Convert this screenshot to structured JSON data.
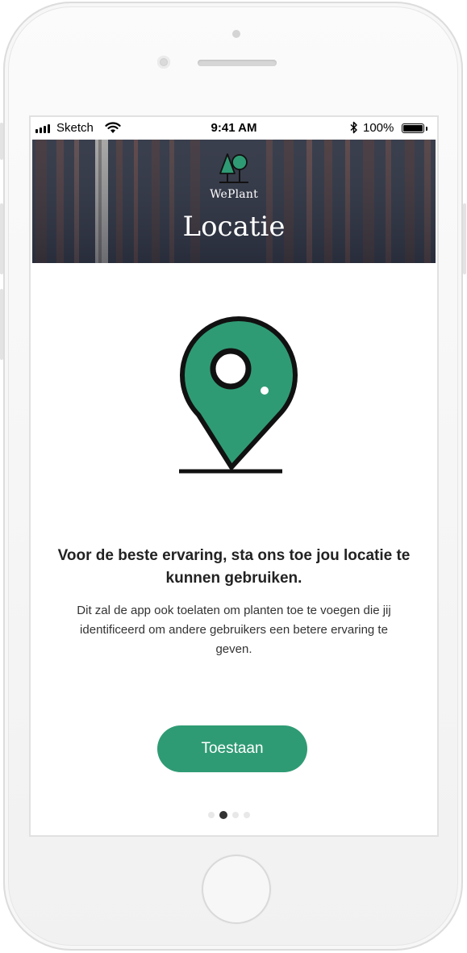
{
  "status_bar": {
    "carrier": "Sketch",
    "time": "9:41 AM",
    "battery": "100%"
  },
  "header": {
    "brand": "WePlant",
    "title": "Locatie"
  },
  "permission": {
    "icon": "location-pin-icon",
    "headline": "Voor de beste ervaring, sta ons toe jou locatie te kunnen gebruiken.",
    "description": "Dit zal de app ook toelaten om planten toe te voegen die jij identificeerd om andere gebruikers een betere ervaring te geven.",
    "button": "Toestaan"
  },
  "pager": {
    "total": 4,
    "active_index": 1
  },
  "colors": {
    "accent": "#2f9b74",
    "pin_green": "#2f9b74",
    "text_dark": "#222222"
  }
}
